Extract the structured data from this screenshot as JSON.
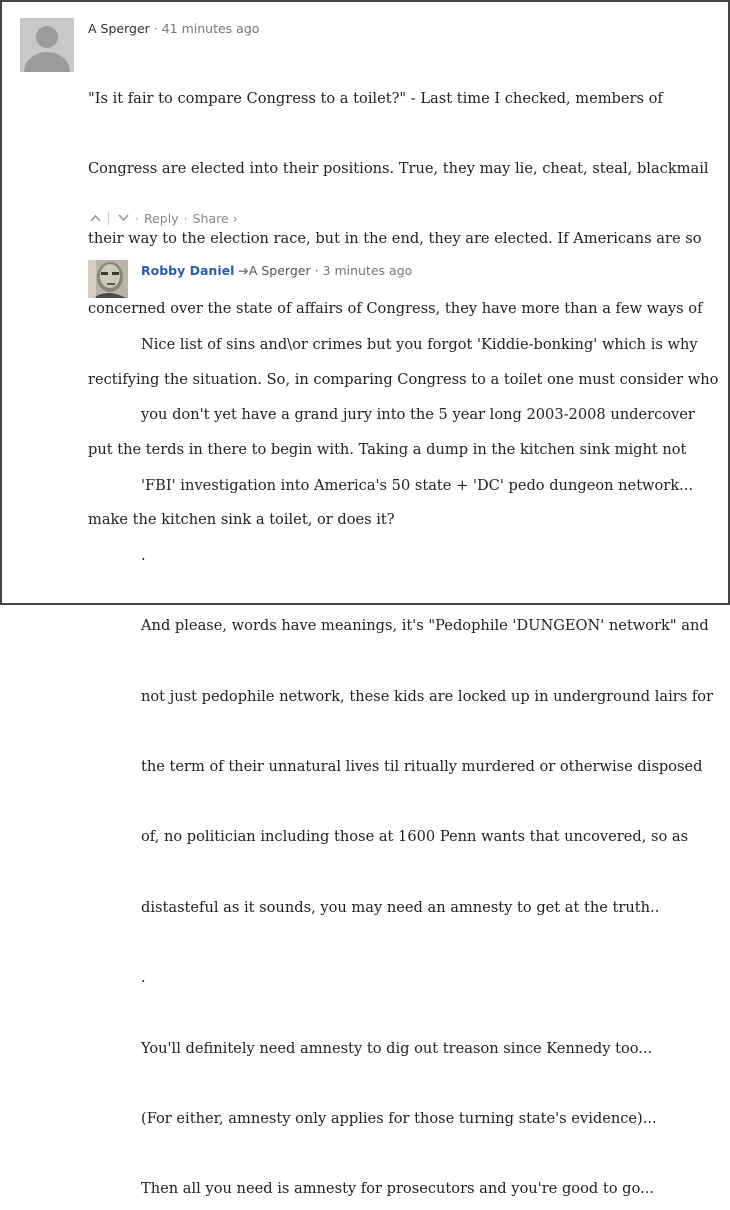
{
  "comment": {
    "author": "A Sperger",
    "separator": " · ",
    "timestamp": "41 minutes ago",
    "lines": [
      "\"Is it fair to compare Congress to a toilet?\" - Last time I checked, members of",
      "Congress are elected into their positions. True, they may lie, cheat, steal, blackmail",
      "their way to the election race, but in the end, they are elected. If Americans are so",
      "concerned over the state of affairs of Congress, they have more than a few ways of",
      "rectifying the situation. So, in comparing Congress to a toilet one must consider who",
      "put the terds in there to begin with. Taking a dump in the kitchen sink might not",
      "make the kitchen sink a toilet, or does it?"
    ],
    "actions": {
      "upvote_icon": "chevron-up-icon",
      "downvote_icon": "chevron-down-icon",
      "reply_label": "Reply",
      "share_label": "Share ›",
      "dot": "·"
    }
  },
  "reply": {
    "author": "Robby Daniel",
    "reply_icon": "reply-arrow-icon",
    "arrow_glyph": "➔",
    "reply_to": "A Sperger",
    "separator": " · ",
    "timestamp": "3 minutes ago",
    "lines": [
      "Nice list of sins and\\or crimes but you forgot 'Kiddie-bonking' which is why",
      "you don't yet have a grand jury into the 5 year long 2003-2008 undercover",
      "'FBI' investigation into America's 50 state + 'DC' pedo dungeon network...",
      ".",
      "And please, words have meanings, it's \"Pedophile 'DUNGEON' network\" and",
      "not just pedophile network, these kids are locked up in underground lairs for",
      "the term of their unnatural lives til ritually murdered or otherwise disposed",
      "of, no politician including those at 1600 Penn wants that uncovered, so as",
      "distasteful as it sounds, you may need an amnesty to get at the truth..",
      ".",
      "You'll definitely need amnesty to dig out treason since Kennedy too...",
      "(For either, amnesty only applies for those turning state's evidence)...",
      "Then all you need is amnesty for prosecutors and you're good to go..."
    ]
  },
  "colors": {
    "author_link": "#2a5db0",
    "meta_text": "#777777",
    "body_text": "#222222",
    "border": "#444444"
  }
}
